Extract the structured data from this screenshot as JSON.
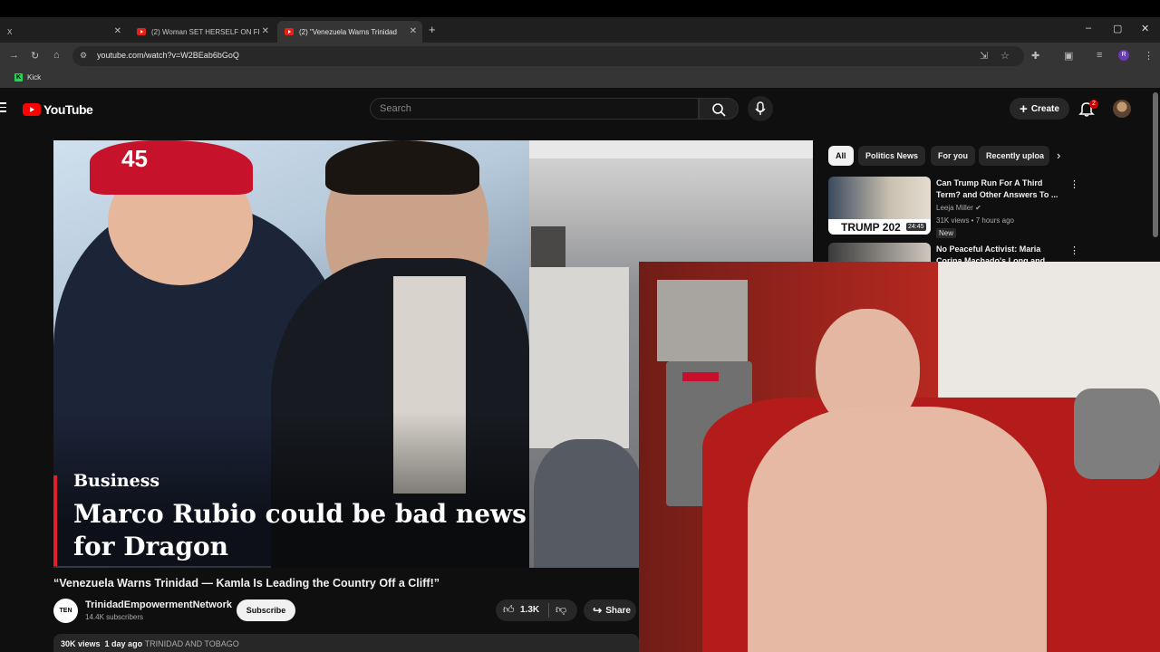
{
  "browser": {
    "tabs": [
      {
        "label": "X",
        "active": false
      },
      {
        "label": "(2) Woman SET HERSELF ON FI",
        "active": false
      },
      {
        "label": "(2) \"Venezuela Warns Trinidad",
        "active": true
      }
    ],
    "url": "youtube.com/watch?v=W2BEab6bGoQ",
    "bookmarks": [
      {
        "label": "Kick"
      }
    ]
  },
  "yt": {
    "logo": "YouTube",
    "search_placeholder": "Search",
    "create_label": "Create",
    "notification_count": "2",
    "profile_initial": "R"
  },
  "video": {
    "thumbnail_tag": "Business",
    "thumbnail_headline": "Marco Rubio could be bad news for Dragon",
    "cap_number": "45",
    "title": "“Venezuela Warns Trinidad — Kamla Is Leading the Country Off a Cliff!”",
    "channel": "TrinidadEmpowermentNetwork",
    "channel_avatar": "TEN",
    "subscribers": "14.4K subscribers",
    "subscribe_label": "Subscribe",
    "likes": "1.3K",
    "share_label": "Share",
    "views": "30K views",
    "age": "1 day ago",
    "tag": "TRINIDAD AND TOBAGO"
  },
  "sidebar": {
    "chips": [
      "All",
      "Politics News",
      "For you",
      "Recently uploa"
    ],
    "recommendations": [
      {
        "title": "Can Trump Run For A Third Term? and Other Answers To ...",
        "channel": "Leeja Miller",
        "meta": "31K views • 7 hours ago",
        "badge": "New",
        "duration": "24:45",
        "thumb_text": "TRUMP 202"
      },
      {
        "title": "No Peaceful Activist: Maria Corina Machado's Long and",
        "channel": "",
        "meta": "",
        "badge": "",
        "duration": "",
        "thumb_text": ""
      }
    ]
  },
  "colors": {
    "bg": "#0f0f0f",
    "brand_red": "#ff0000",
    "chip_bg": "#272727"
  }
}
